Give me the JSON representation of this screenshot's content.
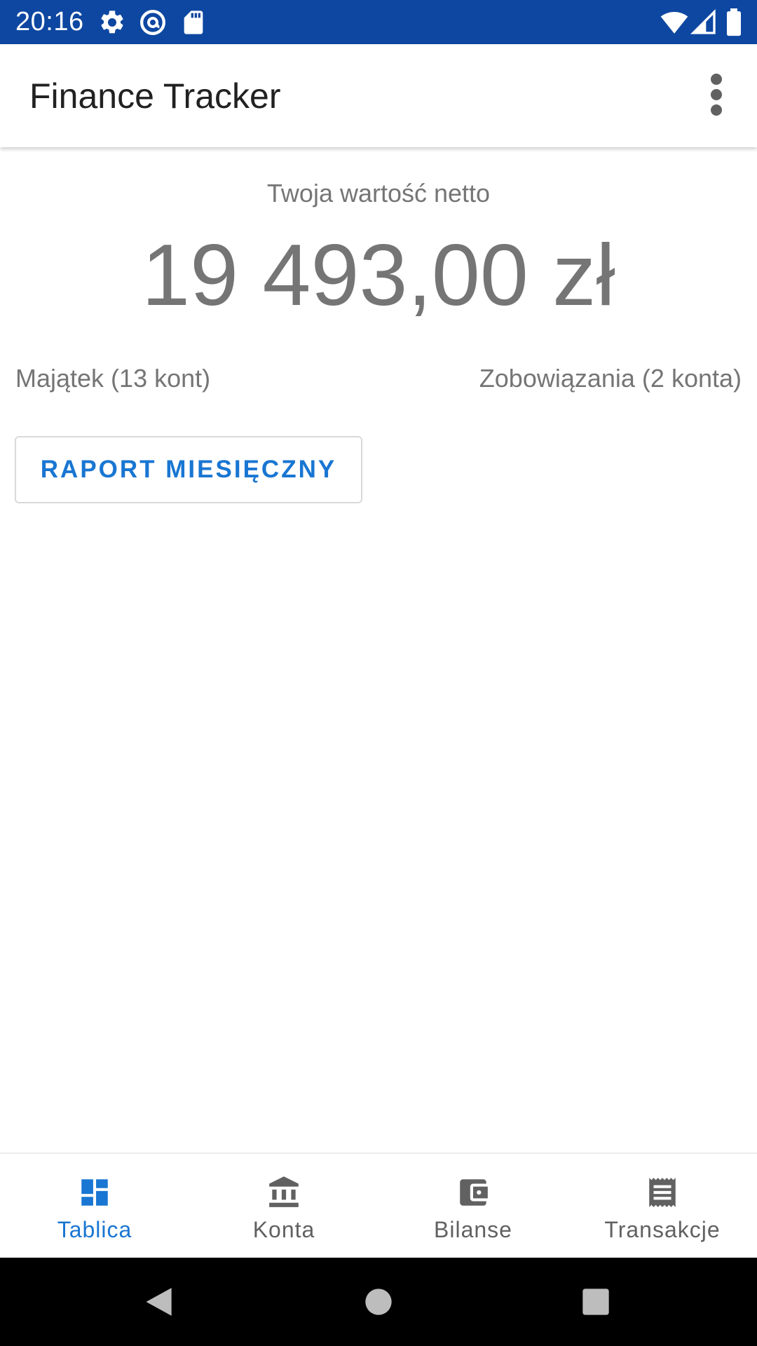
{
  "status_bar": {
    "time": "20:16",
    "left_icons": [
      "gear-icon",
      "at-sign-icon",
      "sd-card-icon"
    ],
    "right_icons": [
      "wifi-icon",
      "cell-signal-icon",
      "battery-icon"
    ],
    "background_color": "#0d47a1"
  },
  "app_bar": {
    "title": "Finance Tracker",
    "overflow_icon": "more-vert-icon"
  },
  "main": {
    "networth_label": "Twoja wartość netto",
    "networth_value": "19 493,00 zł",
    "assets_label": "Majątek (13 kont)",
    "liabilities_label": "Zobowiązania (2 konta)",
    "report_button_label": "RAPORT MIESIĘCZNY"
  },
  "bottom_nav": {
    "active_color": "#1976d2",
    "items": [
      {
        "label": "Tablica",
        "icon": "dashboard-icon",
        "active": true
      },
      {
        "label": "Konta",
        "icon": "bank-icon",
        "active": false
      },
      {
        "label": "Bilanse",
        "icon": "wallet-icon",
        "active": false
      },
      {
        "label": "Transakcje",
        "icon": "receipt-icon",
        "active": false
      }
    ]
  },
  "system_nav": {
    "buttons": [
      "back-icon",
      "home-icon",
      "recents-icon"
    ]
  }
}
